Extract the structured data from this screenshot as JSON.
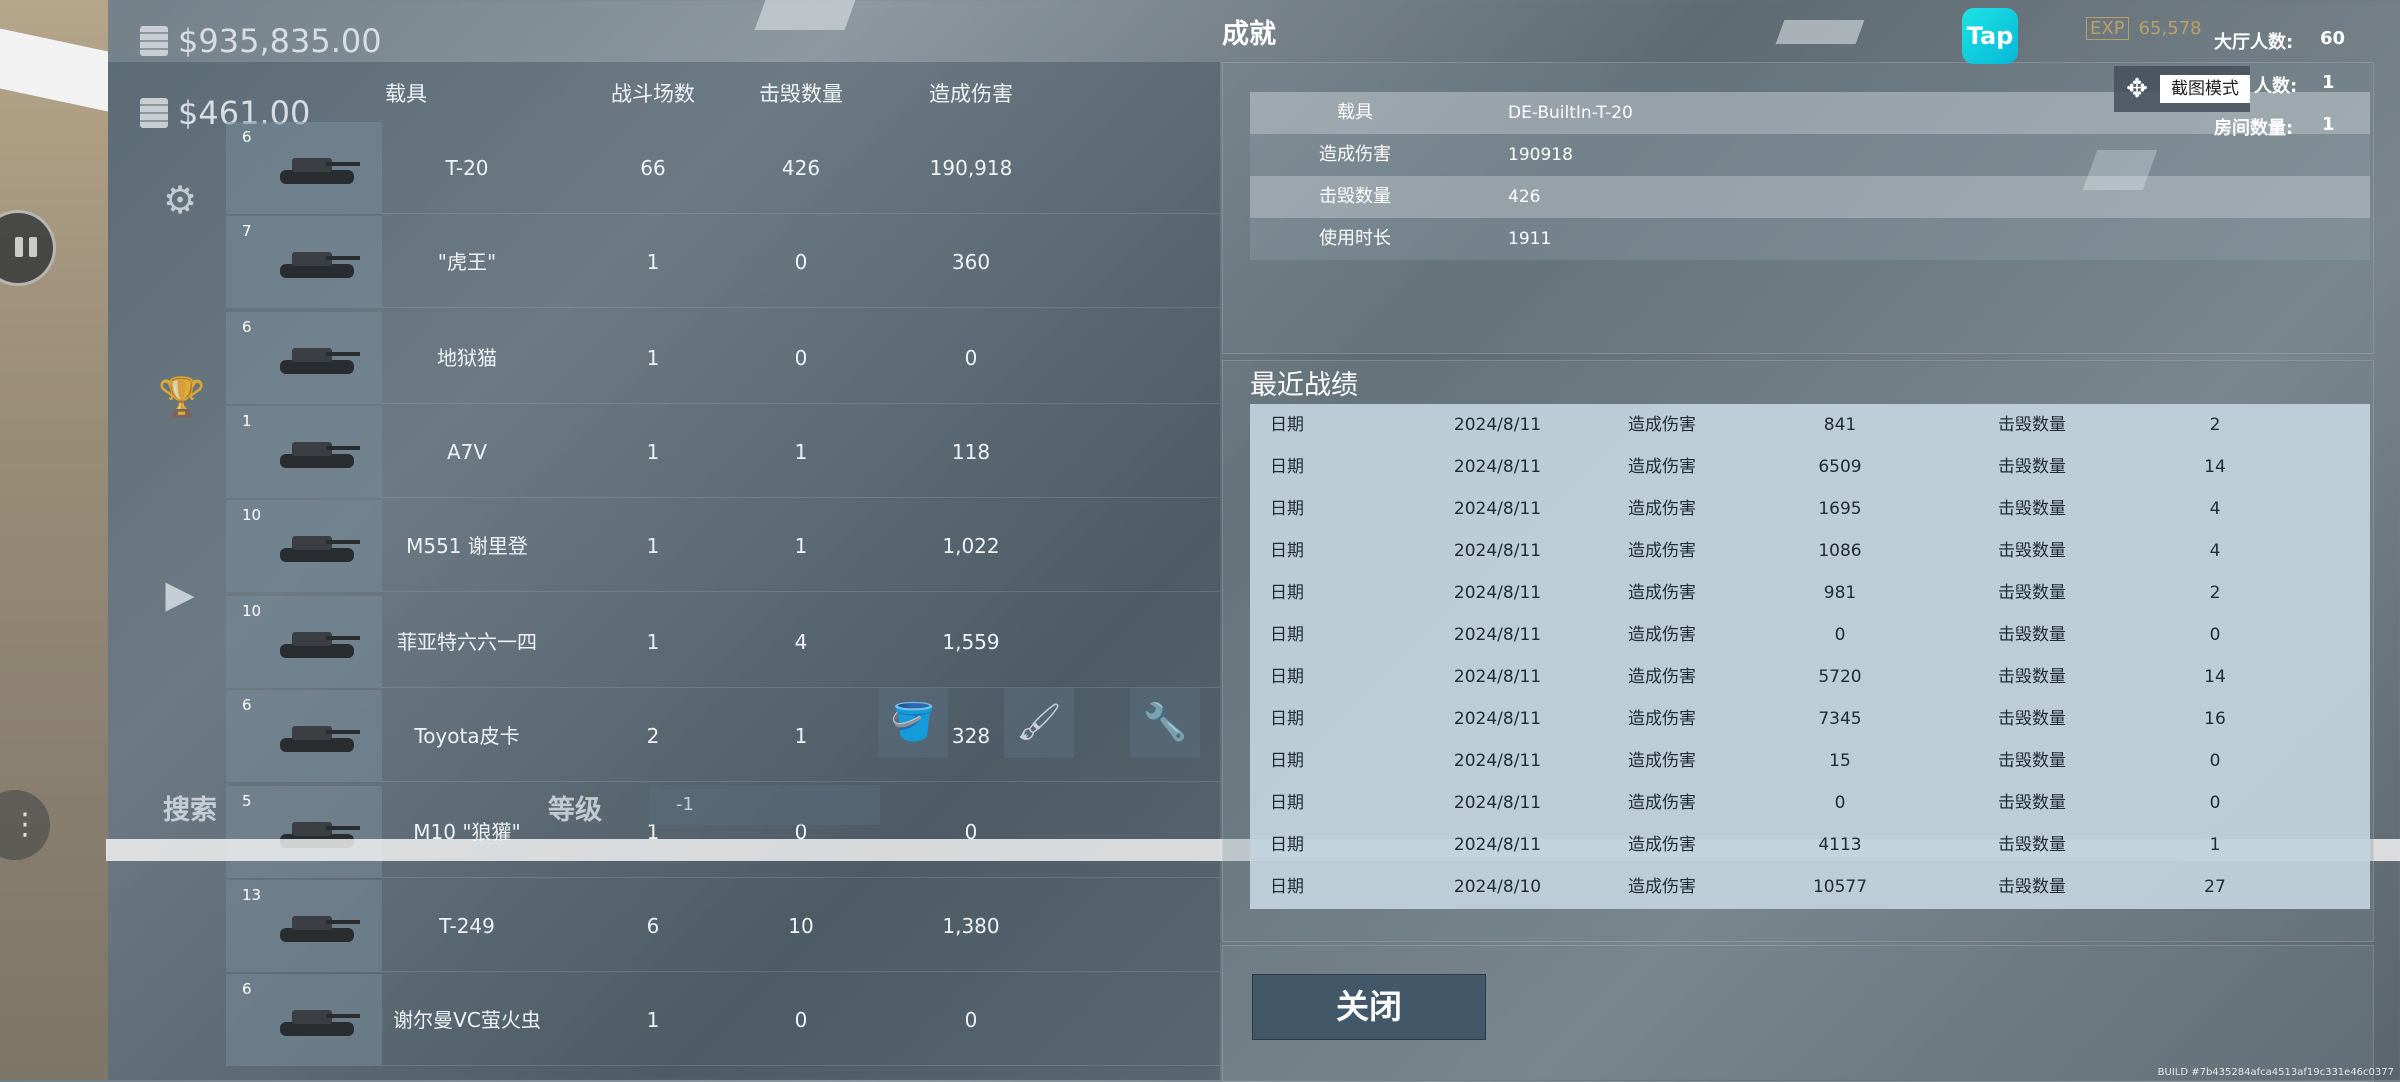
{
  "header": {
    "title": "成就"
  },
  "currency": {
    "cash": "$935,835.00",
    "gold": "$461.00"
  },
  "columns": [
    "载具",
    "战斗场数",
    "击毁数量",
    "造成伤害"
  ],
  "vehicles": [
    {
      "tier": "6",
      "name": "T-20",
      "battles": "66",
      "kills": "426",
      "damage": "190,918"
    },
    {
      "tier": "7",
      "name": "\"虎王\"",
      "battles": "1",
      "kills": "0",
      "damage": "360"
    },
    {
      "tier": "6",
      "name": "地狱猫",
      "battles": "1",
      "kills": "0",
      "damage": "0"
    },
    {
      "tier": "1",
      "name": "A7V",
      "battles": "1",
      "kills": "1",
      "damage": "118"
    },
    {
      "tier": "10",
      "name": "M551 谢里登",
      "battles": "1",
      "kills": "1",
      "damage": "1,022"
    },
    {
      "tier": "10",
      "name": "菲亚特六六一四",
      "battles": "1",
      "kills": "4",
      "damage": "1,559"
    },
    {
      "tier": "6",
      "name": "Toyota皮卡",
      "battles": "2",
      "kills": "1",
      "damage": "328"
    },
    {
      "tier": "5",
      "name": "M10 \"狼獾\"",
      "battles": "1",
      "kills": "0",
      "damage": "0"
    },
    {
      "tier": "13",
      "name": "T-249",
      "battles": "6",
      "kills": "10",
      "damage": "1,380"
    },
    {
      "tier": "6",
      "name": "谢尔曼VC萤火虫",
      "battles": "1",
      "kills": "0",
      "damage": "0"
    }
  ],
  "filters": {
    "search_label": "搜索",
    "level_label": "等级",
    "level_value": "-1"
  },
  "detail": [
    {
      "key": "载具",
      "value": "DE-BuiltIn-T-20"
    },
    {
      "key": "造成伤害",
      "value": "190918"
    },
    {
      "key": "击毁数量",
      "value": "426"
    },
    {
      "key": "使用时长",
      "value": "1911"
    }
  ],
  "recent": {
    "title": "最近战绩",
    "rows": [
      {
        "date_label": "日期",
        "date": "2024/8/11",
        "damage_label": "造成伤害",
        "damage": "841",
        "kills_label": "击毁数量",
        "kills": "2"
      },
      {
        "date_label": "日期",
        "date": "2024/8/11",
        "damage_label": "造成伤害",
        "damage": "6509",
        "kills_label": "击毁数量",
        "kills": "14"
      },
      {
        "date_label": "日期",
        "date": "2024/8/11",
        "damage_label": "造成伤害",
        "damage": "1695",
        "kills_label": "击毁数量",
        "kills": "4"
      },
      {
        "date_label": "日期",
        "date": "2024/8/11",
        "damage_label": "造成伤害",
        "damage": "1086",
        "kills_label": "击毁数量",
        "kills": "4"
      },
      {
        "date_label": "日期",
        "date": "2024/8/11",
        "damage_label": "造成伤害",
        "damage": "981",
        "kills_label": "击毁数量",
        "kills": "2"
      },
      {
        "date_label": "日期",
        "date": "2024/8/11",
        "damage_label": "造成伤害",
        "damage": "0",
        "kills_label": "击毁数量",
        "kills": "0"
      },
      {
        "date_label": "日期",
        "date": "2024/8/11",
        "damage_label": "造成伤害",
        "damage": "5720",
        "kills_label": "击毁数量",
        "kills": "14"
      },
      {
        "date_label": "日期",
        "date": "2024/8/11",
        "damage_label": "造成伤害",
        "damage": "7345",
        "kills_label": "击毁数量",
        "kills": "16"
      },
      {
        "date_label": "日期",
        "date": "2024/8/11",
        "damage_label": "造成伤害",
        "damage": "15",
        "kills_label": "击毁数量",
        "kills": "0"
      },
      {
        "date_label": "日期",
        "date": "2024/8/11",
        "damage_label": "造成伤害",
        "damage": "0",
        "kills_label": "击毁数量",
        "kills": "0"
      },
      {
        "date_label": "日期",
        "date": "2024/8/11",
        "damage_label": "造成伤害",
        "damage": "4113",
        "kills_label": "击毁数量",
        "kills": "1"
      },
      {
        "date_label": "日期",
        "date": "2024/8/10",
        "damage_label": "造成伤害",
        "damage": "10577",
        "kills_label": "击毁数量",
        "kills": "27"
      }
    ]
  },
  "close_label": "关闭",
  "top_right": {
    "tap_label": "Tap",
    "exp_badge": "EXP",
    "exp_value": "65,578",
    "lobby_label": "大厅人数:",
    "lobby_value": "60",
    "players_label": "人数:",
    "players_value": "1",
    "rooms_label": "房间数量:",
    "rooms_value": "1",
    "screenshot_mode": "截图模式"
  },
  "build": "BUILD #7b435284afca4513af19c331e46c0377",
  "icons": [
    "gear-icon",
    "trophy-icon",
    "video-icon",
    "pause-icon",
    "grid-icon",
    "paint-bucket-icon",
    "brush-icon",
    "wrench-icon",
    "move-icon",
    "coin-icon"
  ]
}
